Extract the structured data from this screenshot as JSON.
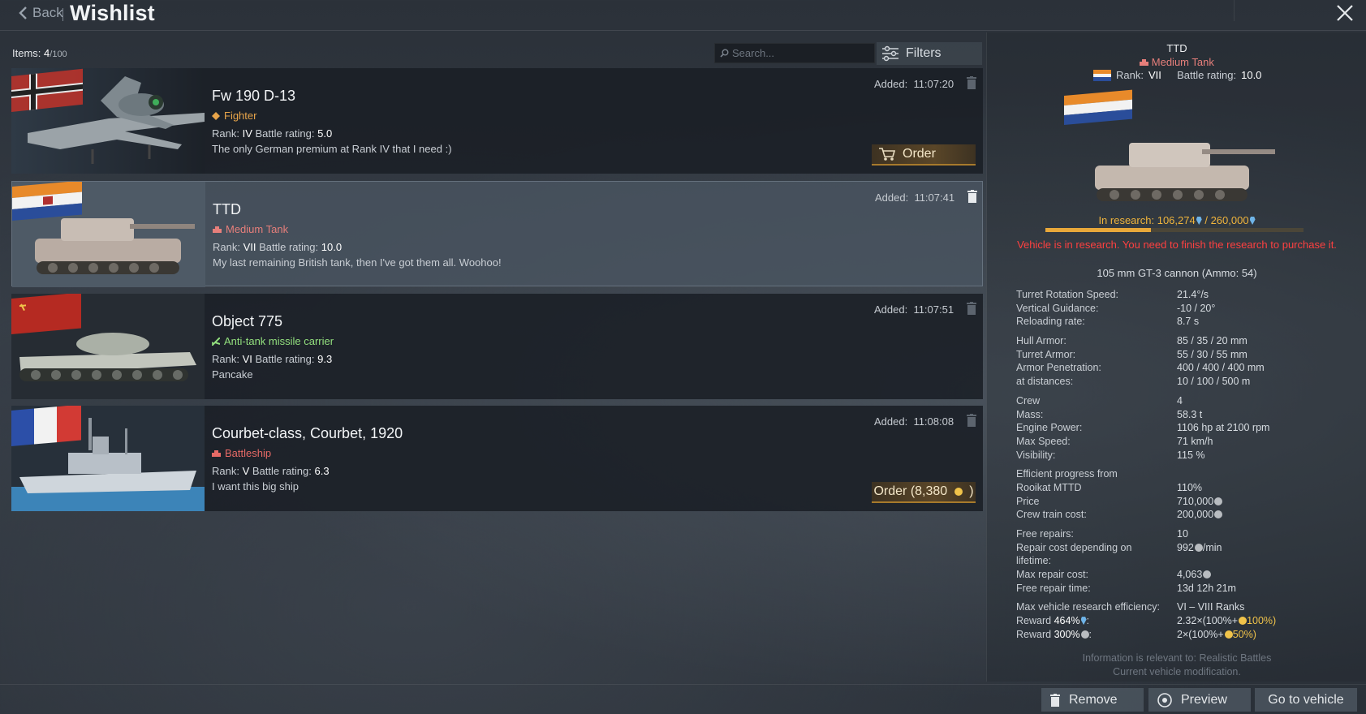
{
  "header": {
    "back_label": "Back",
    "title": "Wishlist"
  },
  "toolbar": {
    "items_label": "Items:",
    "items_count": "4",
    "items_max": "/100",
    "search_placeholder": "Search...",
    "filters_label": "Filters"
  },
  "items": [
    {
      "name": "Fw 190 D-13",
      "type": "Fighter",
      "rank_label": "Rank:",
      "rank": "IV",
      "br_label": "Battle rating:",
      "br": "5.0",
      "note": "The only German premium at Rank IV that I need :)",
      "added_label": "Added:",
      "added": "11:07:20",
      "button": "Order",
      "nation": "Germany"
    },
    {
      "name": "TTD",
      "type": "Medium Tank",
      "rank_label": "Rank:",
      "rank": "VII",
      "br_label": "Battle rating:",
      "br": "10.0",
      "note": "My last remaining British tank, then I've got them all. Woohoo!",
      "added_label": "Added:",
      "added": "11:07:41",
      "nation": "South Africa"
    },
    {
      "name": "Object 775",
      "type": "Anti-tank missile carrier",
      "rank_label": "Rank:",
      "rank": "VI",
      "br_label": "Battle rating:",
      "br": "9.3",
      "note": "Pancake",
      "added_label": "Added:",
      "added": "11:07:51",
      "nation": "USSR"
    },
    {
      "name": "Courbet-class, Courbet, 1920",
      "type": "Battleship",
      "rank_label": "Rank:",
      "rank": "V",
      "br_label": "Battle rating:",
      "br": "6.3",
      "note": "I want this big ship",
      "added_label": "Added:",
      "added": "11:08:08",
      "button": "Order (8,380",
      "button_suffix": ")",
      "nation": "France"
    }
  ],
  "panel": {
    "name": "TTD",
    "type": "Medium Tank",
    "rank_label": "Rank:",
    "rank": "VII",
    "br_label": "Battle rating:",
    "br": "10.0",
    "research_label": "In research:",
    "research_current": "106,274",
    "research_total": "/ 260,000",
    "research_progress": 0.4087,
    "research_warning": "Vehicle is in research. You need to finish the research to purchase it.",
    "cannon": "105 mm GT-3 cannon (Ammo: 54)",
    "stats": [
      {
        "k": "Turret Rotation Speed:",
        "v": "21.4°/s"
      },
      {
        "k": "Vertical Guidance:",
        "v": "-10 / 20°"
      },
      {
        "k": "Reloading rate:",
        "v": "8.7 s"
      },
      {
        "k": "Hull Armor:",
        "v": "85 / 35 / 20 mm"
      },
      {
        "k": "Turret Armor:",
        "v": "55 / 30 / 55 mm"
      },
      {
        "k": "Armor Penetration:",
        "v": "400 / 400 / 400 mm"
      },
      {
        "k": "at distances:",
        "v": "10 / 100 / 500 m"
      },
      {
        "k": "Crew",
        "v": "4"
      },
      {
        "k": "Mass:",
        "v": "58.3 t"
      },
      {
        "k": "Engine Power:",
        "v": "1106 hp at 2100 rpm"
      },
      {
        "k": "Max Speed:",
        "v": "71 km/h"
      },
      {
        "k": "Visibility:",
        "v": "115 %"
      },
      {
        "k": "Efficient progress from",
        "v": ""
      },
      {
        "k": "Rooikat MTTD",
        "v": "110%"
      },
      {
        "k": "Price",
        "v": "710,000"
      },
      {
        "k": "Crew train cost:",
        "v": "200,000"
      },
      {
        "k": "Free repairs:",
        "v": "10"
      },
      {
        "k": "Repair cost depending on",
        "v": "992"
      },
      {
        "k": "lifetime:",
        "v": ""
      },
      {
        "k": "Max repair cost:",
        "v": "4,063"
      },
      {
        "k": "Free repair time:",
        "v": "13d 12h 21m"
      },
      {
        "k": "Max vehicle research efficiency:",
        "v": "VI – VIII Ranks"
      },
      {
        "k": "Reward",
        "v": "2.32×(100%+"
      },
      {
        "k": "Reward",
        "v": "2×(100%+"
      }
    ],
    "repair_unit": "/min",
    "reward1_pct": "464%",
    "reward1_bonus": "100%)",
    "reward2_pct": "300%",
    "reward2_bonus": "50%)",
    "info_line1": "Information is relevant to: Realistic Battles",
    "info_line2": "Current vehicle modification."
  },
  "bottom": {
    "remove": "Remove",
    "preview": "Preview",
    "goto": "Go to vehicle"
  },
  "colors": {
    "accent_gold": "#f0b43c",
    "warning_red": "#ff4040",
    "tank_red": "#e77f7b",
    "fighter_orange": "#e8a54a",
    "atgm_green": "#93e07e"
  }
}
